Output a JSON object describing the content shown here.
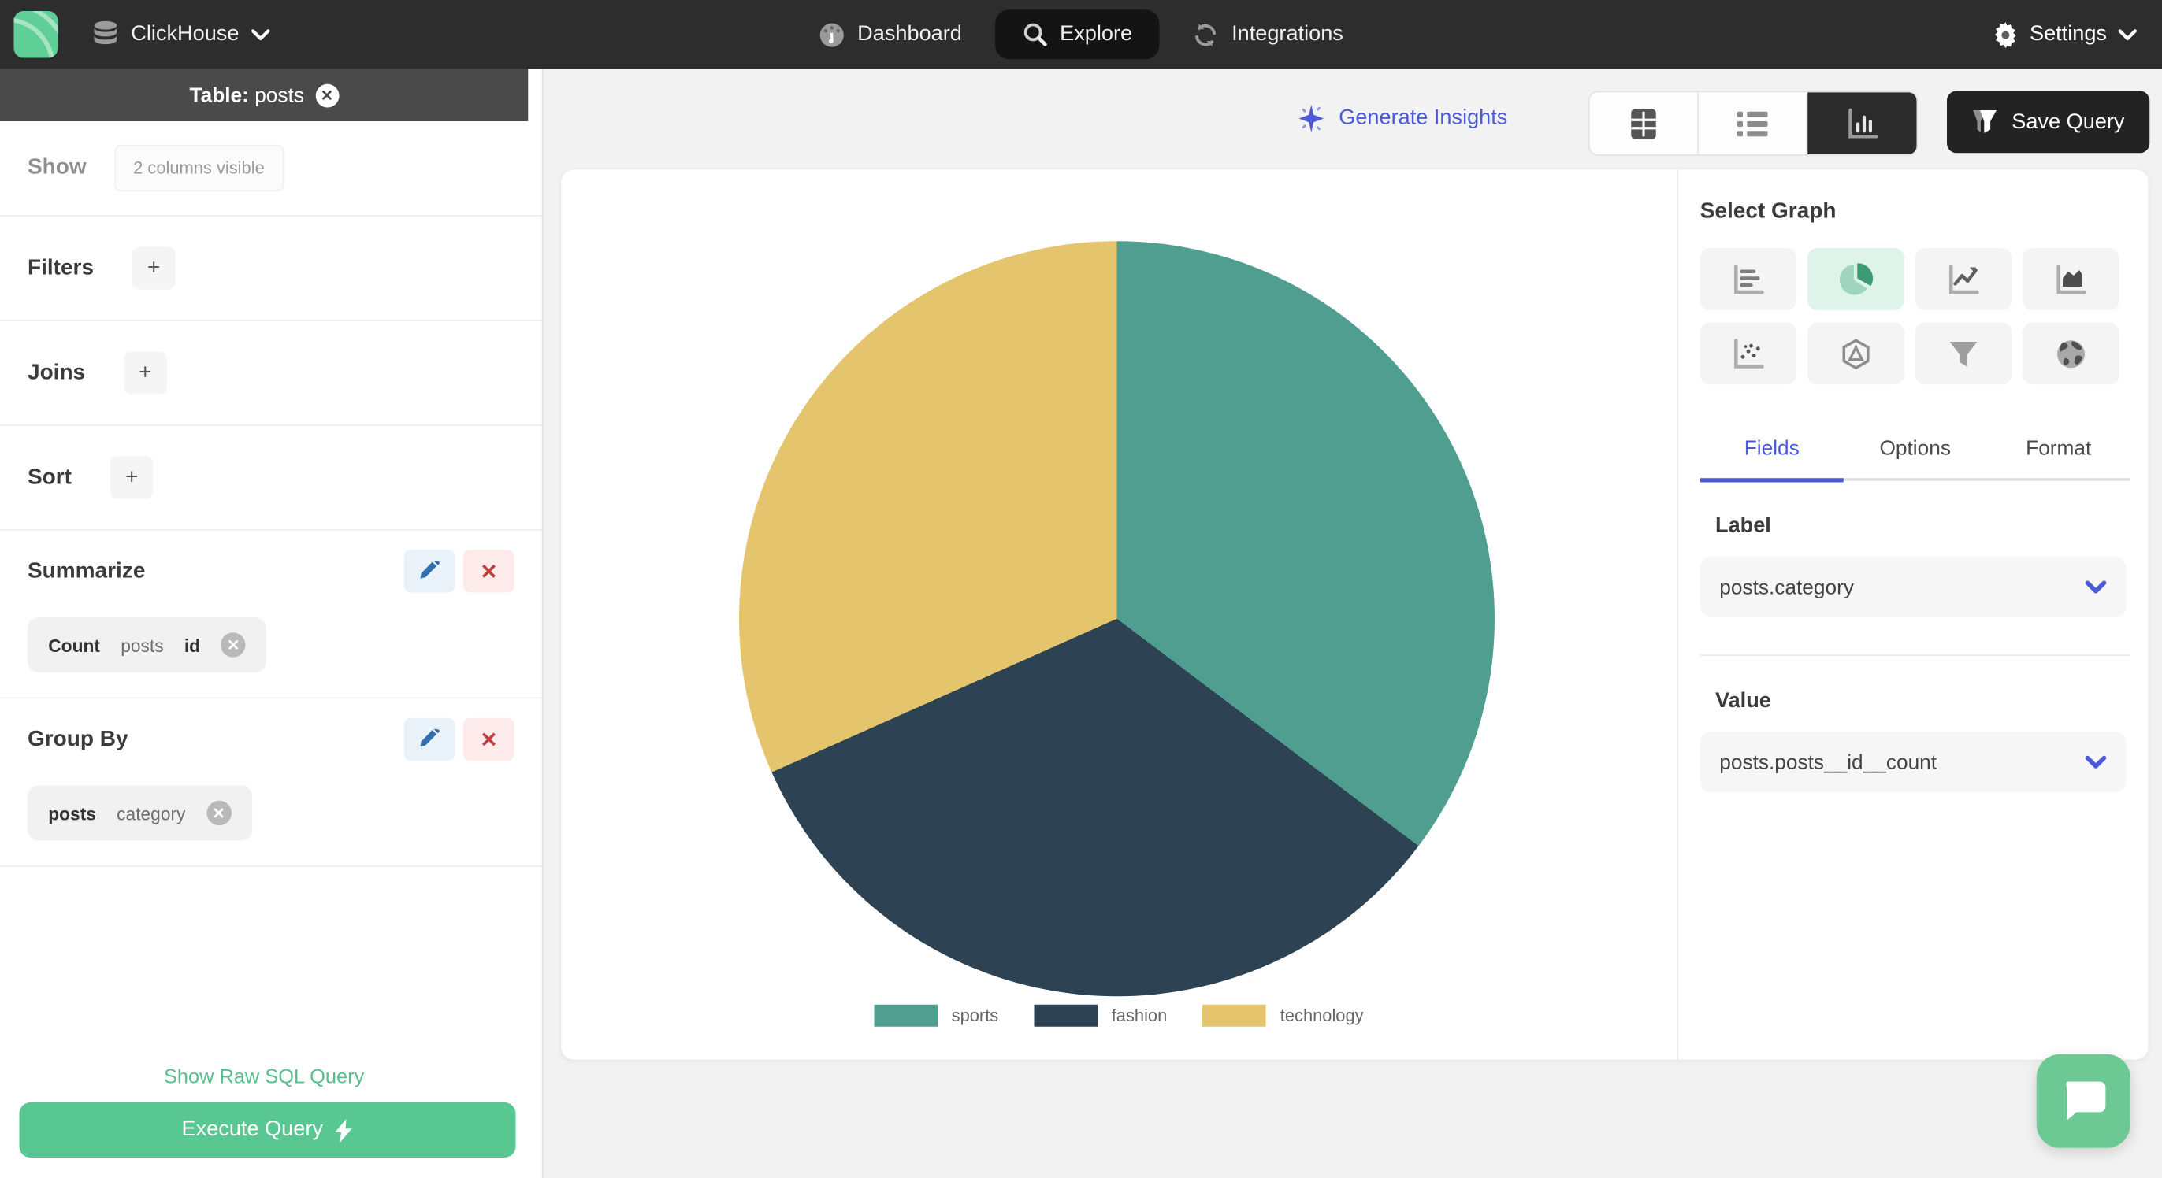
{
  "navbar": {
    "brand": "ClickHouse",
    "items": [
      {
        "label": "Dashboard",
        "icon": "gauge-icon",
        "active": false
      },
      {
        "label": "Explore",
        "icon": "search-icon",
        "active": true
      },
      {
        "label": "Integrations",
        "icon": "sync-icon",
        "active": false
      }
    ],
    "settings_label": "Settings"
  },
  "sidebar": {
    "table_header": {
      "prefix": "Table:",
      "name": "posts"
    },
    "show": {
      "label": "Show",
      "chip": "2 columns visible"
    },
    "sections": [
      {
        "label": "Filters",
        "add": "+"
      },
      {
        "label": "Joins",
        "add": "+"
      },
      {
        "label": "Sort",
        "add": "+"
      }
    ],
    "summarize": {
      "label": "Summarize",
      "chip": {
        "aggregate": "Count",
        "table": "posts",
        "column": "id"
      }
    },
    "group_by": {
      "label": "Group By",
      "chip": {
        "table": "posts",
        "column": "category"
      }
    },
    "raw_sql_link": "Show Raw SQL Query",
    "execute_button": "Execute Query"
  },
  "toolbar": {
    "generate_insights": "Generate Insights",
    "save_query": "Save Query",
    "view_toggle_icons": [
      "table-view-icon",
      "list-view-icon",
      "chart-view-icon"
    ],
    "active_view": "chart"
  },
  "graph_panel": {
    "title": "Select Graph",
    "graph_types": [
      "horizontal-bar-chart-icon",
      "pie-chart-icon",
      "line-chart-icon",
      "area-chart-icon",
      "scatter-plot-icon",
      "radar-chart-icon",
      "funnel-chart-icon",
      "geo-map-icon"
    ],
    "active_graph": "pie",
    "tabs": [
      {
        "label": "Fields",
        "active": true
      },
      {
        "label": "Options",
        "active": false
      },
      {
        "label": "Format",
        "active": false
      }
    ],
    "label_field": {
      "heading": "Label",
      "value": "posts.category"
    },
    "value_field": {
      "heading": "Value",
      "value": "posts.posts__id__count"
    }
  },
  "chart_data": {
    "type": "pie",
    "categories": [
      "sports",
      "fashion",
      "technology"
    ],
    "values": [
      35.3,
      33.0,
      31.7
    ],
    "angles_deg": [
      127,
      119,
      114
    ],
    "start_angle_deg": 0,
    "colors": [
      "#4f9e90",
      "#2d4252",
      "#e4c46c"
    ],
    "title": "",
    "legend_position": "bottom"
  },
  "colors": {
    "accent_green": "#58c792",
    "accent_indigo": "#4c59d8",
    "navbar_bg": "#2d2d2d",
    "table_header_bg": "#4a4a4a",
    "danger_red": "#bf3f3f",
    "edit_blue": "#2f6fae"
  }
}
